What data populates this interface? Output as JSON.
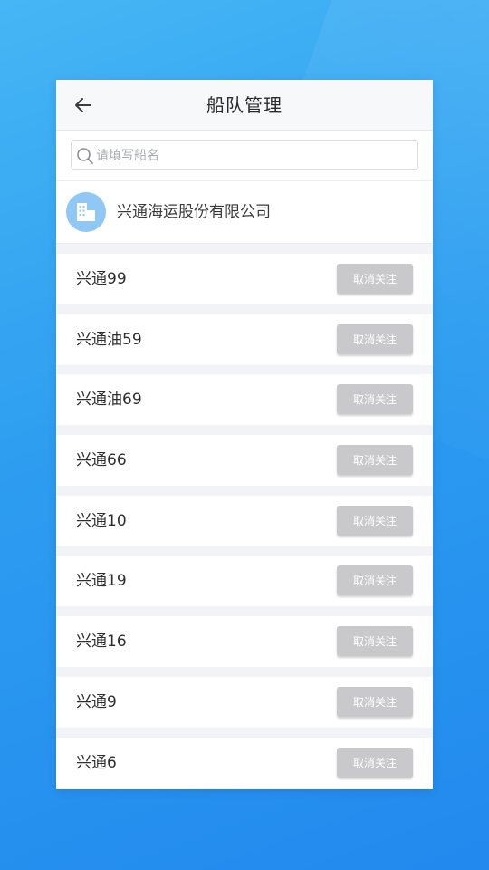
{
  "header": {
    "title": "船队管理",
    "back_icon": "arrow-left-icon"
  },
  "search": {
    "placeholder": "请填写船名",
    "value": "",
    "icon": "search-icon"
  },
  "company": {
    "name": "兴通海运股份有限公司",
    "avatar_icon": "building-icon"
  },
  "ships": [
    {
      "name": "兴通99",
      "action": "取消关注"
    },
    {
      "name": "兴通油59",
      "action": "取消关注"
    },
    {
      "name": "兴通油69",
      "action": "取消关注"
    },
    {
      "name": "兴通66",
      "action": "取消关注"
    },
    {
      "name": "兴通10",
      "action": "取消关注"
    },
    {
      "name": "兴通19",
      "action": "取消关注"
    },
    {
      "name": "兴通16",
      "action": "取消关注"
    },
    {
      "name": "兴通9",
      "action": "取消关注"
    },
    {
      "name": "兴通6",
      "action": "取消关注"
    }
  ],
  "colors": {
    "background": "#2d9df0",
    "avatar": "#8fc7f5",
    "button": "#c9c9cb"
  }
}
